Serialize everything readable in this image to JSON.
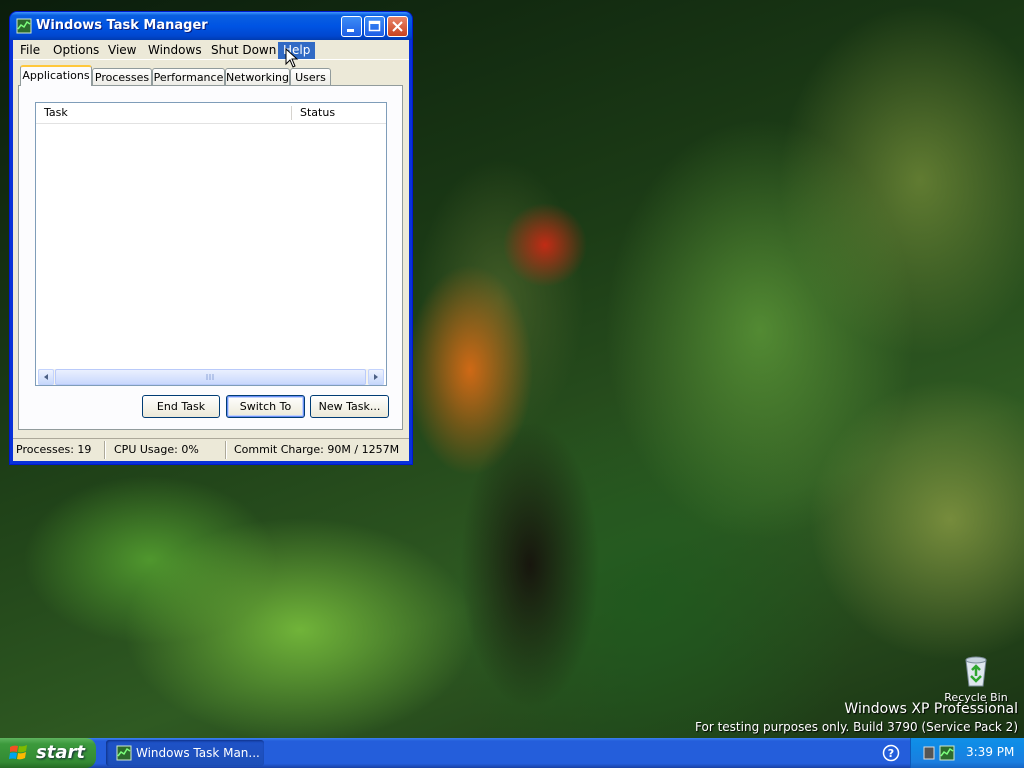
{
  "window": {
    "title": "Windows Task Manager",
    "menu": [
      "File",
      "Options",
      "View",
      "Windows",
      "Shut Down",
      "Help"
    ],
    "active_menu": "Help",
    "tabs": [
      "Applications",
      "Processes",
      "Performance",
      "Networking",
      "Users"
    ],
    "selected_tab": "Applications",
    "list_columns": [
      "Task",
      "Status"
    ],
    "buttons": {
      "end_task": "End Task",
      "switch_to": "Switch To",
      "new_task": "New Task..."
    },
    "status": {
      "processes": "Processes: 19",
      "cpu": "CPU Usage: 0%",
      "commit": "Commit Charge: 90M / 1257M"
    }
  },
  "desktop": {
    "recycle_bin_label": "Recycle Bin",
    "watermark_line1": "Windows XP Professional",
    "watermark_line2": "For testing purposes only. Build 3790 (Service Pack 2)"
  },
  "taskbar": {
    "start_label": "start",
    "task_button_label": "Windows Task Man...",
    "clock": "3:39 PM"
  },
  "colors": {
    "title_bar": "#0054e3",
    "menu_highlight": "#316ac5",
    "taskbar": "#245edb",
    "start_button": "#3c9a3c",
    "tray": "#0f8ce6"
  }
}
